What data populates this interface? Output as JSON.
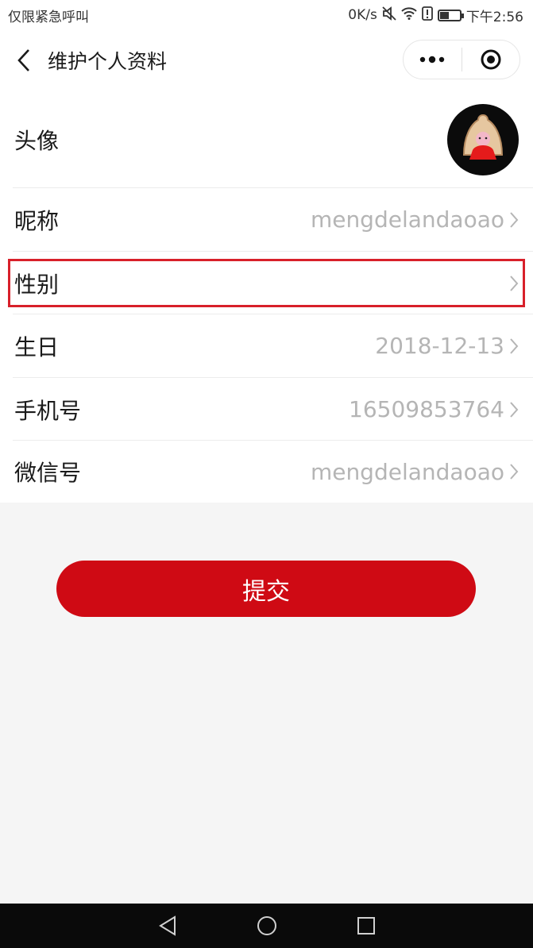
{
  "status_bar": {
    "left_text": "仅限紧急呼叫",
    "net_speed": "0K/s",
    "time": "下午2:56",
    "battery_level": 0.45
  },
  "nav": {
    "title": "维护个人资料",
    "back_icon": "chevron-left-icon",
    "more_icon": "more-dots-icon",
    "close_icon": "target-icon"
  },
  "profile": {
    "avatar_label": "头像",
    "nickname_label": "昵称",
    "nickname_value": "mengdelandaoao",
    "gender_label": "性别",
    "gender_value": "",
    "birthday_label": "生日",
    "birthday_value": "2018-12-13",
    "phone_label": "手机号",
    "phone_value": "16509853764",
    "wechat_label": "微信号",
    "wechat_value": "mengdelandaoao"
  },
  "submit_label": "提交",
  "colors": {
    "accent": "#cf0a14",
    "highlight": "#d8202a",
    "value_text": "#b5b5b5"
  }
}
